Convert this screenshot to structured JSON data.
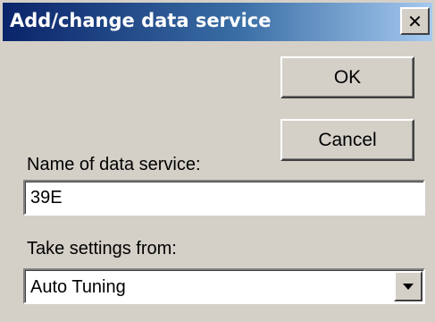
{
  "window": {
    "title": "Add/change data service",
    "close_symbol": "✕"
  },
  "buttons": {
    "ok_label": "OK",
    "cancel_label": "Cancel"
  },
  "name_field": {
    "label": "Name of data service:",
    "value": "39E"
  },
  "settings_field": {
    "label": "Take settings from:",
    "selected": "Auto Tuning"
  },
  "icons": {
    "close": "close-icon",
    "dropdown": "chevron-down-icon"
  },
  "colors": {
    "title_start": "#0a246a",
    "title_end": "#a6caf0",
    "dialog_bg": "#d4d0c8"
  }
}
